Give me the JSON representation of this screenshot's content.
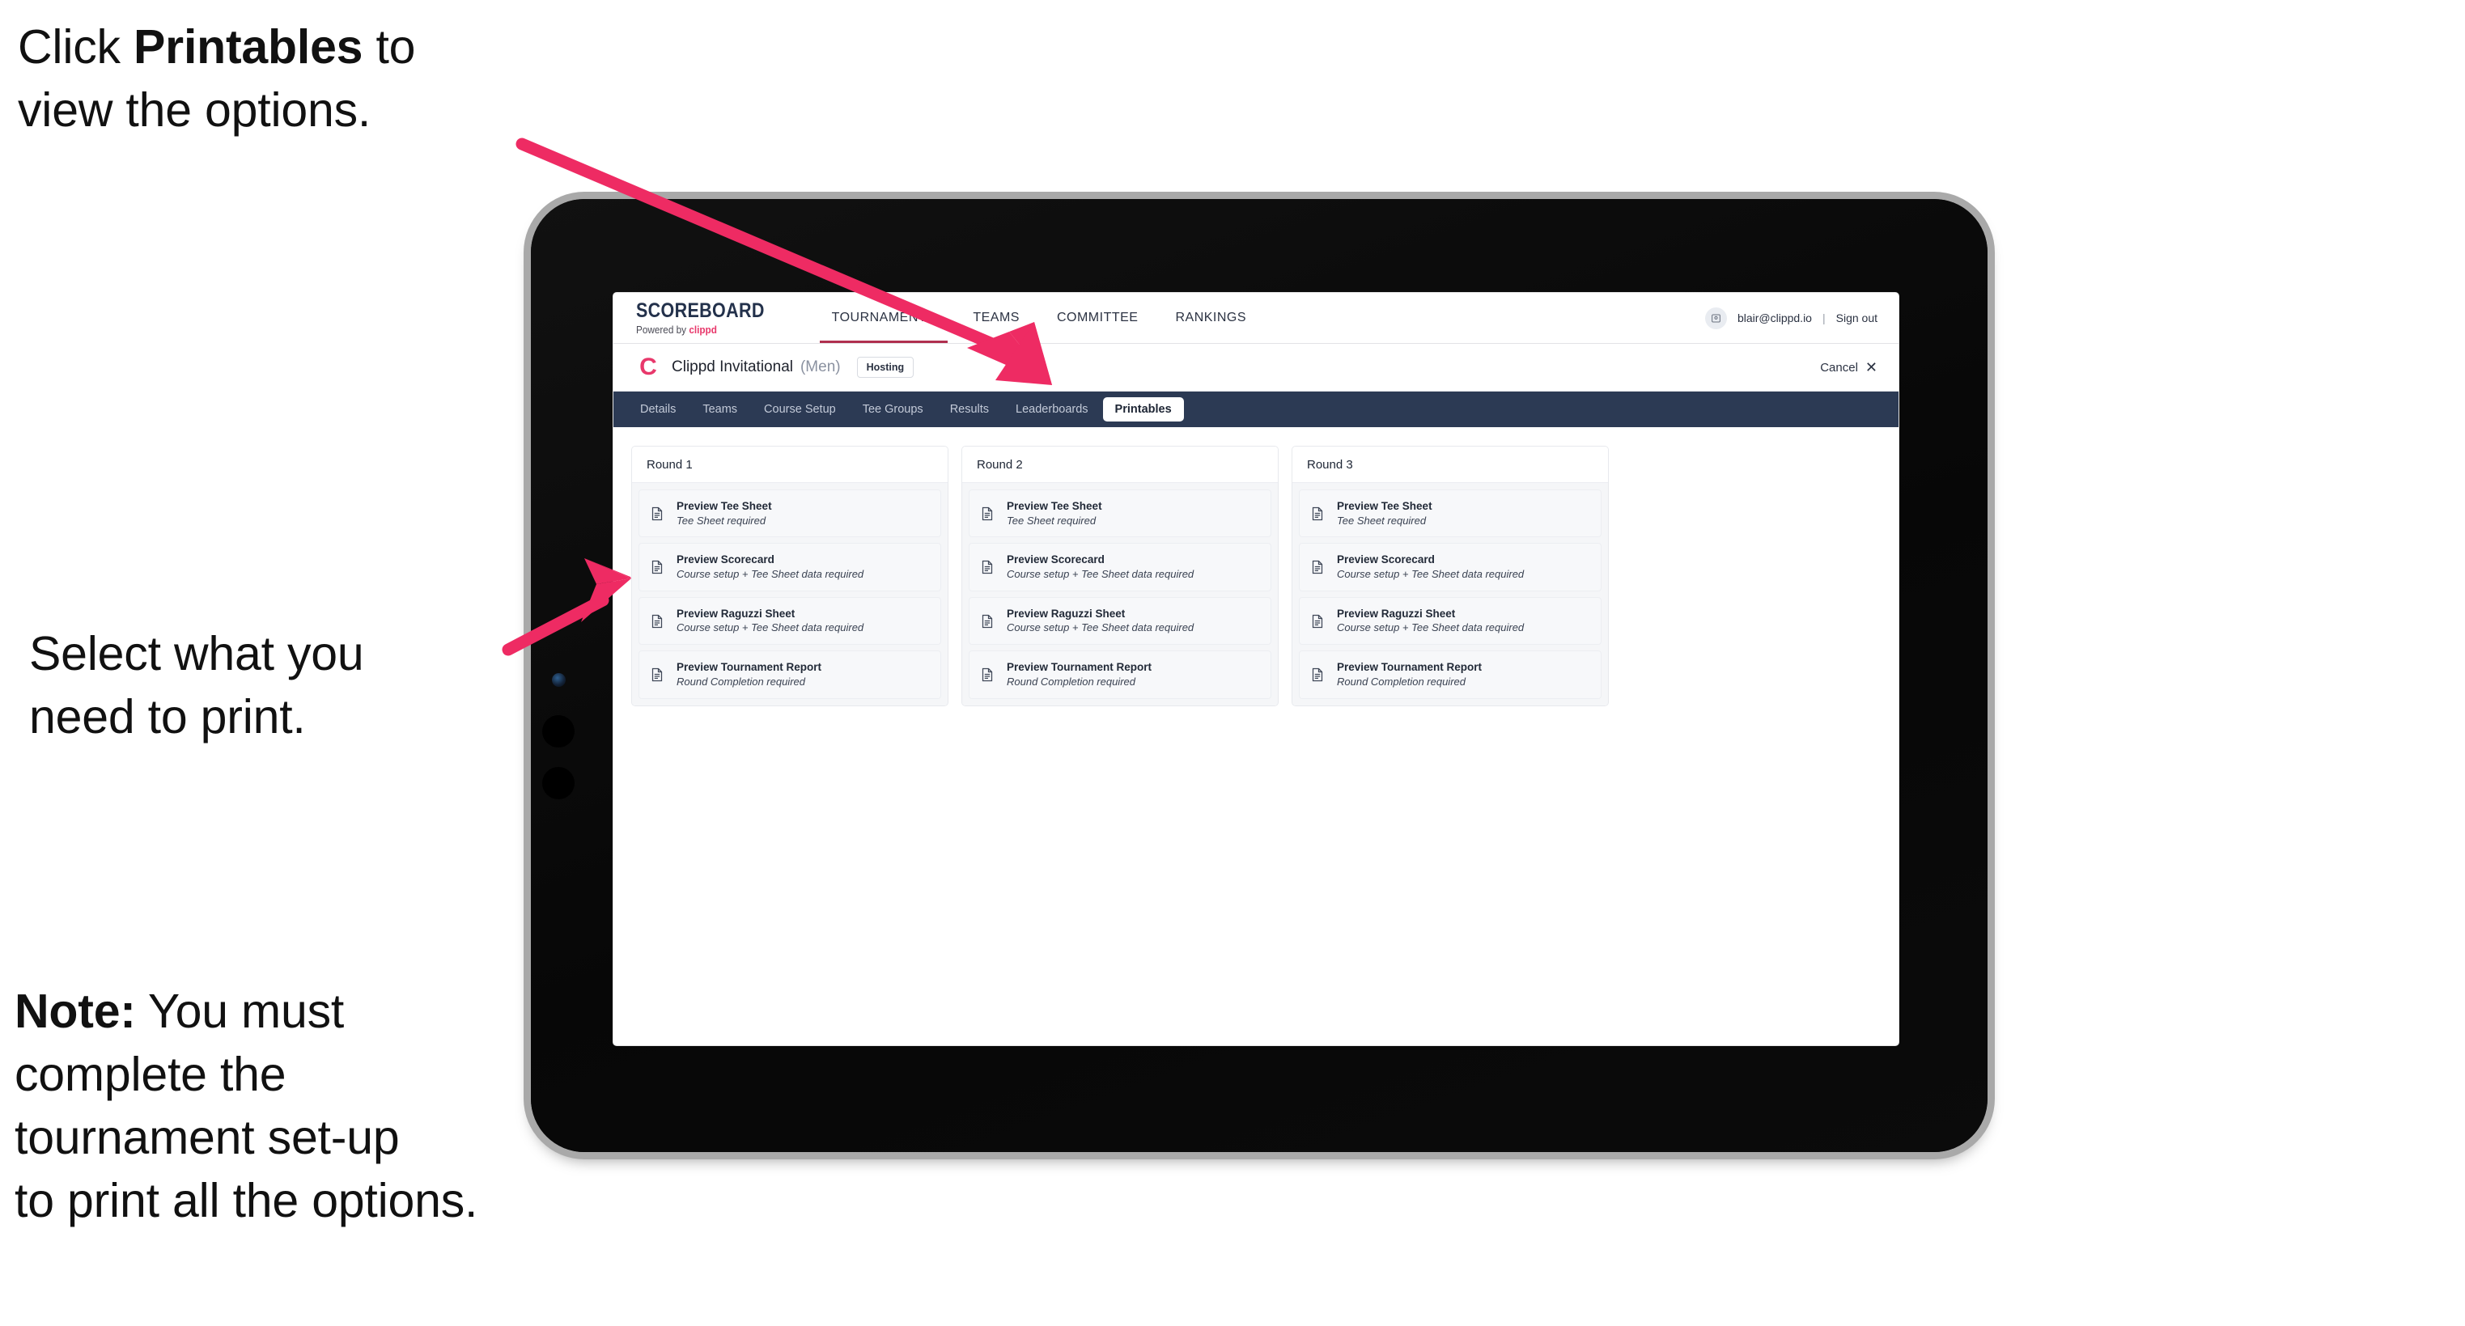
{
  "annotations": {
    "click_printables": {
      "prefix": "Click ",
      "bold": "Printables",
      "suffix": " to\nview the options."
    },
    "select_print": "Select what you\n need to print.",
    "note": {
      "bold": "Note:",
      "rest": " You must\ncomplete the\ntournament set-up\nto print all the options."
    }
  },
  "arrow_color": "#ee2b63",
  "app": {
    "brand": {
      "logo_main": "SCOREBOARD",
      "logo_sub_prefix": "Powered by ",
      "logo_sub_brand": "clippd"
    },
    "main_nav": [
      {
        "label": "TOURNAMENTS",
        "active": true
      },
      {
        "label": "TEAMS",
        "active": false
      },
      {
        "label": "COMMITTEE",
        "active": false
      },
      {
        "label": "RANKINGS",
        "active": false
      }
    ],
    "account": {
      "avatar_icon": "user-avatar-icon",
      "email": "blair@clippd.io",
      "separator": "|",
      "sign_out": "Sign out"
    },
    "tournament": {
      "logo_letter": "C",
      "name": "Clippd Invitational",
      "gender": "(Men)",
      "status_badge": "Hosting",
      "cancel_label": "Cancel",
      "cancel_icon": "close-x-icon"
    },
    "tabs": [
      {
        "label": "Details",
        "active": false
      },
      {
        "label": "Teams",
        "active": false
      },
      {
        "label": "Course Setup",
        "active": false
      },
      {
        "label": "Tee Groups",
        "active": false
      },
      {
        "label": "Results",
        "active": false
      },
      {
        "label": "Leaderboards",
        "active": false
      },
      {
        "label": "Printables",
        "active": true
      }
    ],
    "rounds": [
      {
        "title": "Round 1",
        "items": [
          {
            "icon": "document-icon",
            "title": "Preview Tee Sheet",
            "subtitle": "Tee Sheet required"
          },
          {
            "icon": "document-icon",
            "title": "Preview Scorecard",
            "subtitle": "Course setup + Tee Sheet data required"
          },
          {
            "icon": "document-icon",
            "title": "Preview Raguzzi Sheet",
            "subtitle": "Course setup + Tee Sheet data required"
          },
          {
            "icon": "document-icon",
            "title": "Preview Tournament Report",
            "subtitle": "Round Completion required"
          }
        ]
      },
      {
        "title": "Round 2",
        "items": [
          {
            "icon": "document-icon",
            "title": "Preview Tee Sheet",
            "subtitle": "Tee Sheet required"
          },
          {
            "icon": "document-icon",
            "title": "Preview Scorecard",
            "subtitle": "Course setup + Tee Sheet data required"
          },
          {
            "icon": "document-icon",
            "title": "Preview Raguzzi Sheet",
            "subtitle": "Course setup + Tee Sheet data required"
          },
          {
            "icon": "document-icon",
            "title": "Preview Tournament Report",
            "subtitle": "Round Completion required"
          }
        ]
      },
      {
        "title": "Round 3",
        "items": [
          {
            "icon": "document-icon",
            "title": "Preview Tee Sheet",
            "subtitle": "Tee Sheet required"
          },
          {
            "icon": "document-icon",
            "title": "Preview Scorecard",
            "subtitle": "Course setup + Tee Sheet data required"
          },
          {
            "icon": "document-icon",
            "title": "Preview Raguzzi Sheet",
            "subtitle": "Course setup + Tee Sheet data required"
          },
          {
            "icon": "document-icon",
            "title": "Preview Tournament Report",
            "subtitle": "Round Completion required"
          }
        ]
      }
    ]
  }
}
